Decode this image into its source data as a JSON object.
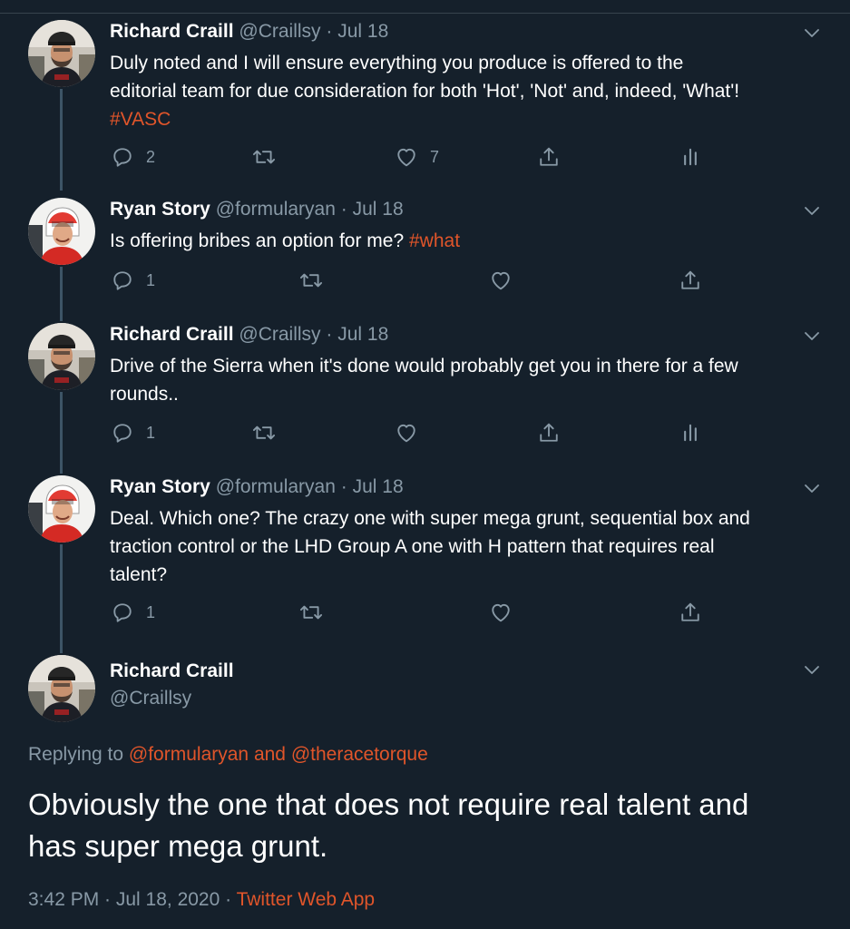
{
  "colors": {
    "background": "#15202b",
    "link": "#e0552a",
    "muted": "#8899a6",
    "thread_line": "#3d5466"
  },
  "replies": [
    {
      "name": "Richard Craill",
      "handle": "@Craillsy",
      "date": "Jul 18",
      "text_lines": [
        "Duly noted and I will ensure everything you produce is offered to the",
        "editorial team for due consideration for both 'Hot', 'Not' and, indeed, 'What'!"
      ],
      "hashtag": "#VASC",
      "reply_count": "2",
      "retweet_count": "",
      "like_count": "7",
      "has_analytics": true
    },
    {
      "name": "Ryan Story",
      "handle": "@formularyan",
      "date": "Jul 18",
      "text": "Is offering bribes an option for me?",
      "hashtag": "#what",
      "reply_count": "1",
      "retweet_count": "",
      "like_count": "",
      "has_analytics": false
    },
    {
      "name": "Richard Craill",
      "handle": "@Craillsy",
      "date": "Jul 18",
      "text_lines": [
        "Drive of the Sierra when it's done would probably get you in there for a few",
        "rounds.."
      ],
      "reply_count": "1",
      "retweet_count": "",
      "like_count": "",
      "has_analytics": true
    },
    {
      "name": "Ryan Story",
      "handle": "@formularyan",
      "date": "Jul 18",
      "text_lines": [
        "Deal. Which one? The crazy one with super mega grunt, sequential box and",
        "traction control or the LHD Group A one with H pattern that requires real",
        "talent?"
      ],
      "reply_count": "1",
      "retweet_count": "",
      "like_count": "",
      "has_analytics": false
    }
  ],
  "main_tweet": {
    "name": "Richard Craill",
    "handle": "@Craillsy",
    "replying_label": "Replying to",
    "replying_user1": "@formularyan",
    "replying_and": "and",
    "replying_user2": "@theracetorque",
    "text_lines": [
      "Obviously the one that does not require real talent and",
      "has super mega grunt."
    ],
    "time": "3:42 PM · Jul 18, 2020 ·",
    "source": "Twitter Web App"
  },
  "separator": " · ",
  "icons": {
    "reply": "reply-icon",
    "retweet": "retweet-icon",
    "like": "heart-icon",
    "share": "share-icon",
    "analytics": "analytics-icon",
    "more": "chevron-down-icon"
  }
}
